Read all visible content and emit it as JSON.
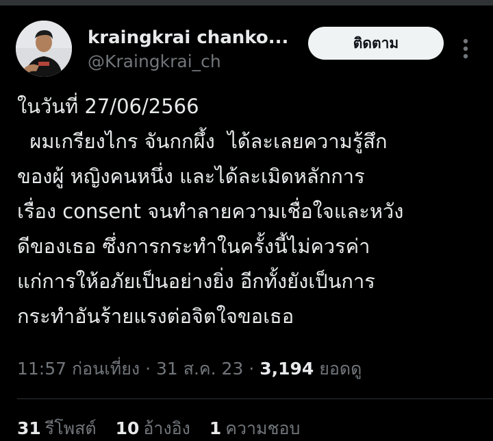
{
  "author": {
    "display_name": "kraingkrai chanko...",
    "handle": "@Kraingkrai_ch",
    "avatar_icon": "profile-photo-icon"
  },
  "follow_button": {
    "label": "ติดตาม"
  },
  "more_button": {
    "icon": "more-vertical-icon"
  },
  "tweet": {
    "lines": [
      "ในวันที่ 27/06/2566",
      "  ผมเกรียงไกร จันกกผึ้ง  ได้ละเลยความรู้สึก",
      "ของผู้ หญิงคนหนึ่ง และได้ละเมิดหลักการ",
      "เรื่อง consent จนทำลายความเชื่อใจและหวัง",
      "ดีของเธอ ซึ่งการกระทำในครั้งนี้ไม่ควรค่า",
      "แก่การให้อภัยเป็นอย่างยิ่ง อีกทั้งยังเป็นการ",
      "กระทำอันร้ายแรงต่อจิตใจขอเธอ"
    ]
  },
  "meta": {
    "time": "11:57 ก่อนเที่ยง",
    "separator": " · ",
    "date": "31 ส.ค. 23",
    "views_count": "3,194",
    "views_label": "ยอดดู"
  },
  "stats": {
    "reposts": {
      "count": "31",
      "label": "รีโพสต์"
    },
    "quotes": {
      "count": "10",
      "label": "อ้างอิง"
    },
    "likes": {
      "count": "1",
      "label": "ความชอบ"
    }
  },
  "colors": {
    "background": "#000000",
    "text_primary": "#e7e9ea",
    "text_secondary": "#71767b",
    "button_bg": "#eff3f4",
    "button_text": "#0f1419",
    "divider": "#2f3336"
  }
}
